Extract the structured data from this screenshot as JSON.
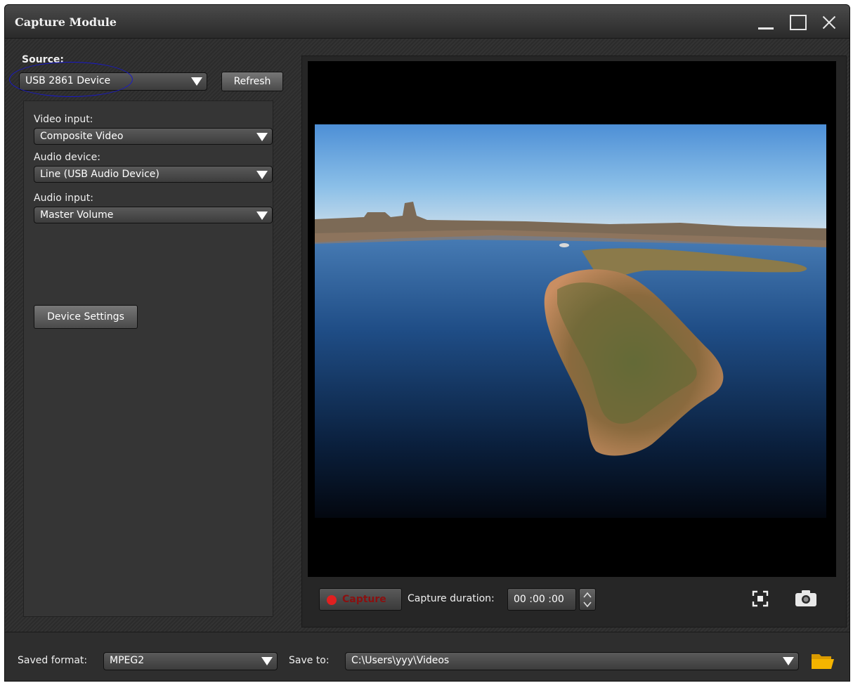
{
  "window": {
    "title": "Capture Module"
  },
  "source": {
    "label": "Source:",
    "selected": "USB 2861 Device",
    "refresh_label": "Refresh"
  },
  "settings": {
    "video_input_label": "Video input:",
    "video_input_value": "Composite Video",
    "audio_device_label": "Audio device:",
    "audio_device_value": "Line (USB Audio Device)",
    "audio_input_label": "Audio input:",
    "audio_input_value": "Master Volume",
    "device_settings_label": "Device Settings"
  },
  "controls": {
    "capture_label": "Capture",
    "duration_label": "Capture duration:",
    "duration_value": "00 :00 :00"
  },
  "bottom": {
    "saved_format_label": "Saved format:",
    "saved_format_value": "MPEG2",
    "save_to_label": "Save to:",
    "save_to_value": "C:\\Users\\yyy\\Videos"
  },
  "icons": {
    "minimize": "minimize-icon",
    "maximize": "maximize-icon",
    "close": "close-icon",
    "dropdown": "chevron-down-icon",
    "record": "record-dot-icon",
    "fullscreen": "fullscreen-icon",
    "snapshot": "camera-icon",
    "folder": "folder-icon"
  },
  "colors": {
    "record": "#e02020",
    "highlight_annotation": "#1818c8",
    "folder": "#f4b400"
  }
}
